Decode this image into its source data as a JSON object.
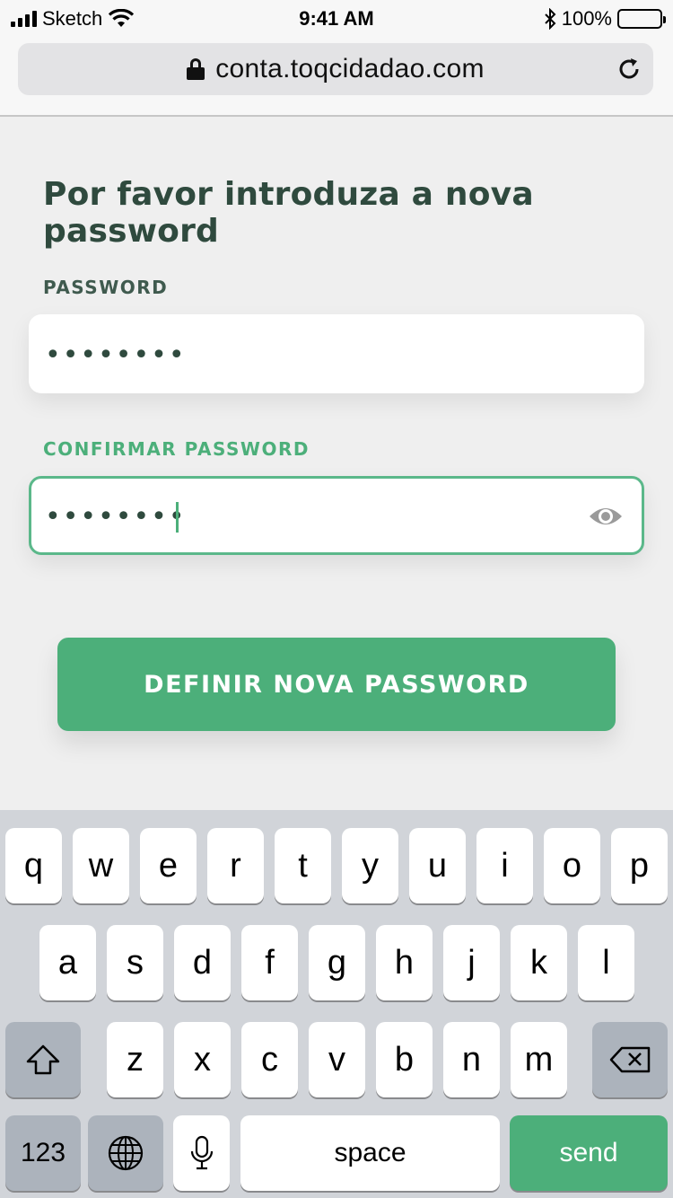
{
  "status_bar": {
    "carrier": "Sketch",
    "time": "9:41 AM",
    "battery": "100%"
  },
  "browser": {
    "url": "conta.toqcidadao.com"
  },
  "form": {
    "title": "Por favor introduza a nova password",
    "password_label": "PASSWORD",
    "password_value": "••••••••",
    "confirm_label": "CONFIRMAR PASSWORD",
    "confirm_value": "••••••••",
    "submit_label": "DEFINIR NOVA PASSWORD"
  },
  "colors": {
    "accent": "#4caf7a",
    "heading": "#2f4a3e",
    "background": "#efefef"
  },
  "keyboard": {
    "row1": [
      "q",
      "w",
      "e",
      "r",
      "t",
      "y",
      "u",
      "i",
      "o",
      "p"
    ],
    "row2": [
      "a",
      "s",
      "d",
      "f",
      "g",
      "h",
      "j",
      "k",
      "l"
    ],
    "row3": [
      "z",
      "x",
      "c",
      "v",
      "b",
      "n",
      "m"
    ],
    "numbers_label": "123",
    "space_label": "space",
    "send_label": "send",
    "icons": [
      "shift-icon",
      "backspace-icon",
      "globe-icon",
      "microphone-icon"
    ]
  }
}
